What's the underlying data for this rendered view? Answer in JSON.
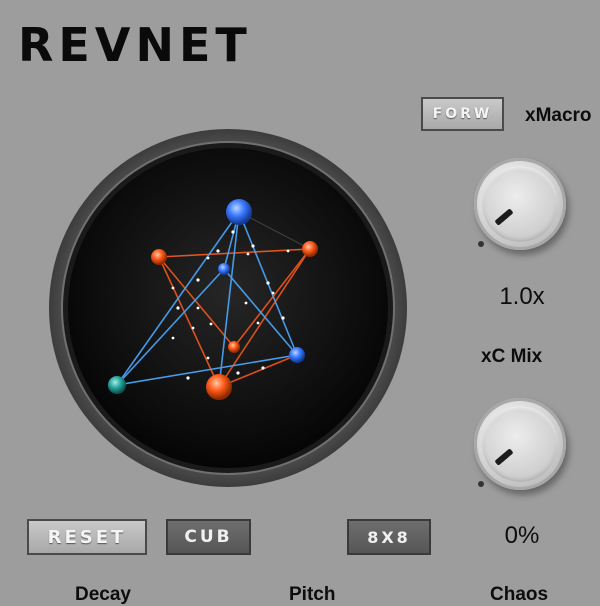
{
  "app": {
    "title": "REVNET"
  },
  "buttons": {
    "forw": "FORW",
    "reset": "RESET",
    "cub": "CUB",
    "grid": "8X8"
  },
  "controls": {
    "xmacro": {
      "label": "xMacro",
      "value": "1.0x"
    },
    "xcmix": {
      "label": "xC Mix",
      "value": "0%"
    }
  },
  "bottom_labels": {
    "decay": "Decay",
    "pitch": "Pitch",
    "chaos": "Chaos"
  },
  "colors": {
    "background": "#9d9d9d",
    "node_blue": "#3b7bff",
    "node_orange": "#ff5a1a",
    "node_teal": "#2aa8a0"
  },
  "icons": [
    "knob-icon",
    "network-graph-icon"
  ]
}
